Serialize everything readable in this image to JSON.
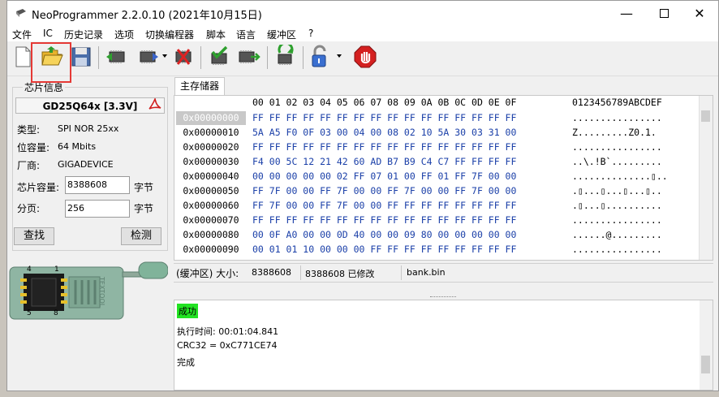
{
  "window": {
    "title": "NeoProgrammer 2.2.0.10 (2021年10月15日)"
  },
  "menu": [
    "文件",
    "IC",
    "历史记录",
    "选项",
    "切换编程器",
    "脚本",
    "语言",
    "缓冲区",
    "?"
  ],
  "toolbar": {
    "buttons": [
      "new-file-icon",
      "open-folder-icon",
      "save-icon",
      "read-chip-icon",
      "write-chip-icon",
      "erase-chip-icon",
      "verify-chip-icon",
      "blank-check-icon",
      "auto-icon",
      "lock-icon",
      "stop-icon"
    ]
  },
  "chip_info": {
    "group_title": "芯片信息",
    "name": "GD25Q64x [3.3V]",
    "type_label": "类型:",
    "type_value": "SPI NOR 25xx",
    "size_label": "位容量:",
    "size_value": "64 Mbits",
    "vendor_label": "厂商:",
    "vendor_value": "GIGADEVICE",
    "capacity_label": "芯片容量:",
    "capacity_value": "8388608",
    "capacity_unit": "字节",
    "page_label": "分页:",
    "page_value": "256",
    "page_unit": "字节",
    "find_button": "查找",
    "detect_button": "检测"
  },
  "socket": {
    "pin_1": "1",
    "pin_4": "4",
    "pin_5": "5",
    "pin_8": "8",
    "brand": "TEXTOOL"
  },
  "hex": {
    "tab": "主存储器",
    "header_cols": "00 01 02 03 04 05 06 07 08 09 0A 0B 0C 0D 0E 0F",
    "header_ascii": "0123456789ABCDEF",
    "rows": [
      {
        "addr": "0x00000000",
        "bytes": "FF FF FF FF FF FF FF FF FF FF FF FF FF FF FF FF",
        "ascii": "................"
      },
      {
        "addr": "0x00000010",
        "bytes": "5A A5 F0 0F 03 00 04 00 08 02 10 5A 30 03 31 00",
        "ascii": "Z.........Z0.1."
      },
      {
        "addr": "0x00000020",
        "bytes": "FF FF FF FF FF FF FF FF FF FF FF FF FF FF FF FF",
        "ascii": "................"
      },
      {
        "addr": "0x00000030",
        "bytes": "F4 00 5C 12 21 42 60 AD B7 B9 C4 C7 FF FF FF FF",
        "ascii": "..\\.!B`........."
      },
      {
        "addr": "0x00000040",
        "bytes": "00 00 00 00 00 02 FF 07 01 00 FF 01 FF 7F 00 00",
        "ascii": "..............▯.."
      },
      {
        "addr": "0x00000050",
        "bytes": "FF 7F 00 00 FF 7F 00 00 FF 7F 00 00 FF 7F 00 00",
        "ascii": ".▯...▯...▯...▯.."
      },
      {
        "addr": "0x00000060",
        "bytes": "FF 7F 00 00 FF 7F 00 00 FF FF FF FF FF FF FF FF",
        "ascii": ".▯...▯.........."
      },
      {
        "addr": "0x00000070",
        "bytes": "FF FF FF FF FF FF FF FF FF FF FF FF FF FF FF FF",
        "ascii": "................"
      },
      {
        "addr": "0x00000080",
        "bytes": "00 0F A0 00 00 0D 40 00 00 09 80 00 00 00 00 00",
        "ascii": "......@........."
      },
      {
        "addr": "0x00000090",
        "bytes": "00 01 01 10 00 00 00 FF FF FF FF FF FF FF FF FF",
        "ascii": "................"
      }
    ]
  },
  "status": {
    "buffer_label": "(缓冲区) 大小:",
    "size": "8388608",
    "modified": "8388608 已修改",
    "file": "bank.bin"
  },
  "log": {
    "success": "成功",
    "exec_time": "执行时间:   00:01:04.841",
    "crc": "CRC32 = 0xC771CE74",
    "done": "完成"
  },
  "colors": {
    "highlight_box": "#e53935",
    "success_bg": "#22e322",
    "hex_text": "#1a3fa8"
  }
}
